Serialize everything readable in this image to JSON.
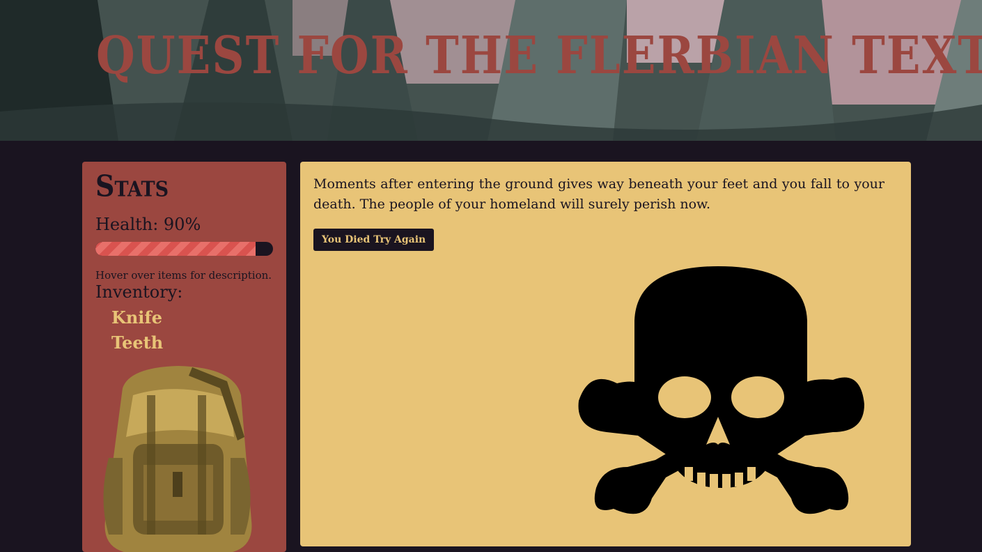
{
  "header": {
    "title": "Quest for the Flerbian Texts"
  },
  "stats": {
    "heading": "Stats",
    "health_label": "Health: 90%",
    "health_value": 0.9,
    "hint": "Hover over items for description.",
    "inventory_title": "Inventory:",
    "items": [
      "Knife",
      "Teeth"
    ],
    "backpack_icon": "backpack-icon"
  },
  "story": {
    "text": "Moments after entering the ground gives way beneath your feet and you fall to your death. The people of your homeland will surely perish now.",
    "retry_label": "You Died Try Again",
    "death_icon": "skull-crossbones-icon"
  },
  "colors": {
    "background": "#1a1420",
    "accent_red": "#9b4740",
    "parchment": "#e8c477"
  }
}
